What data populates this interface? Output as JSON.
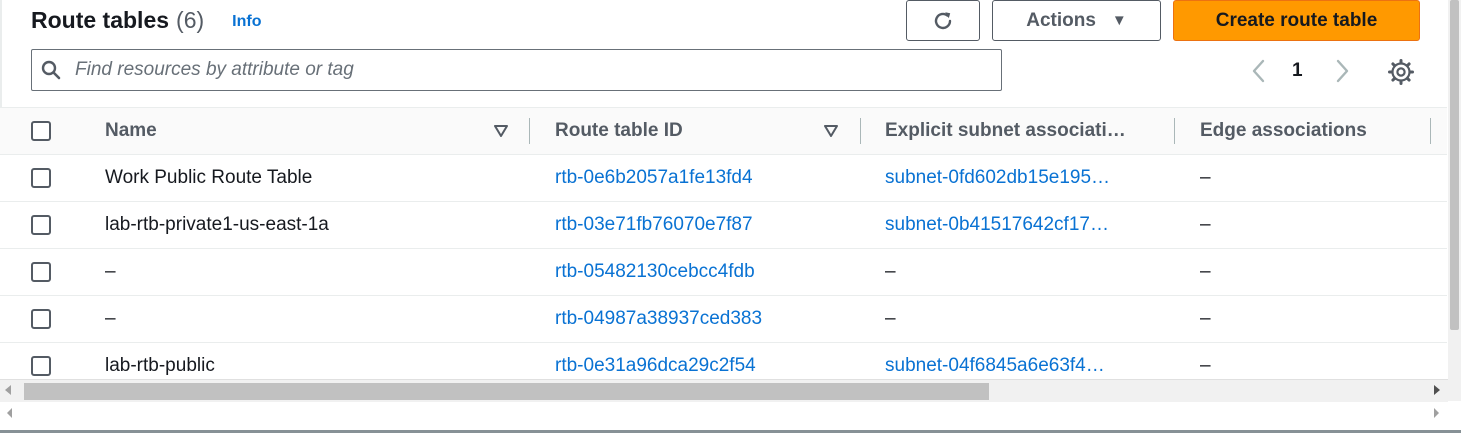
{
  "header": {
    "title": "Route tables",
    "count": "(6)",
    "info_label": "Info",
    "actions_label": "Actions",
    "create_label": "Create route table",
    "refresh_icon": "refresh-icon",
    "actions_caret_icon": "caret-down-icon"
  },
  "search": {
    "placeholder": "Find resources by attribute or tag",
    "value": "",
    "icon": "search-icon"
  },
  "pagination": {
    "current_page": "1",
    "prev_icon": "chevron-left-icon",
    "next_icon": "chevron-right-icon",
    "settings_icon": "gear-icon"
  },
  "table": {
    "columns": [
      {
        "label": "Name"
      },
      {
        "label": "Route table ID"
      },
      {
        "label": "Explicit subnet associati…"
      },
      {
        "label": "Edge associations"
      }
    ],
    "rows": [
      {
        "name": "Work Public Route Table",
        "route_table_id": "rtb-0e6b2057a1fe13fd4",
        "subnet": "subnet-0fd602db15e195…",
        "edge": "–"
      },
      {
        "name": "lab-rtb-private1-us-east-1a",
        "route_table_id": "rtb-03e71fb76070e7f87",
        "subnet": "subnet-0b41517642cf17…",
        "edge": "–"
      },
      {
        "name": "–",
        "route_table_id": "rtb-05482130cebcc4fdb",
        "subnet": "–",
        "edge": "–"
      },
      {
        "name": "–",
        "route_table_id": "rtb-04987a38937ced383",
        "subnet": "–",
        "edge": "–"
      },
      {
        "name": "lab-rtb-public",
        "route_table_id": "rtb-0e31a96dca29c2f54",
        "subnet": "subnet-04f6845a6e63f4…",
        "edge": "–"
      }
    ]
  },
  "colors": {
    "accent_orange": "#ff9900",
    "link_blue": "#0972d3",
    "text_dark": "#16191f",
    "text_muted": "#545b64"
  }
}
